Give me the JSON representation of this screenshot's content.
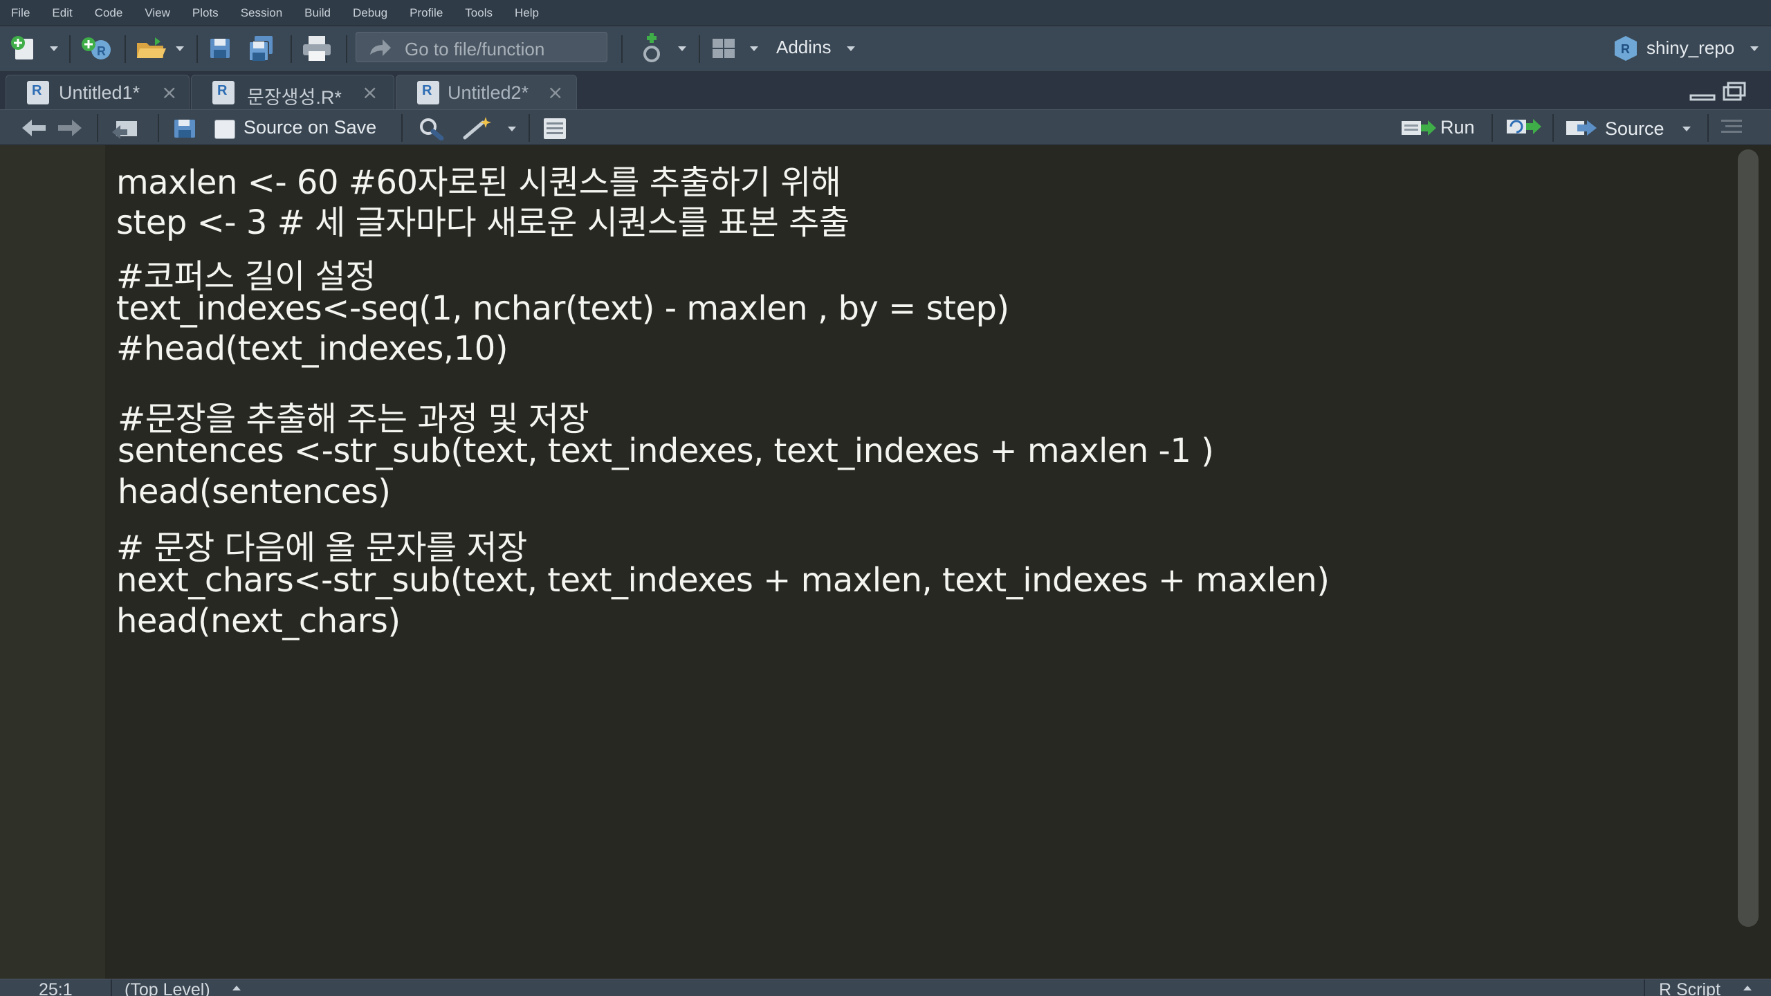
{
  "menu": [
    "File",
    "Edit",
    "Code",
    "View",
    "Plots",
    "Session",
    "Build",
    "Debug",
    "Profile",
    "Tools",
    "Help"
  ],
  "toolbar": {
    "goto_placeholder": "Go to file/function",
    "addins_label": "Addins",
    "project_label": "shiny_repo"
  },
  "tabs": [
    {
      "label": "Untitled1*",
      "active": false
    },
    {
      "label": "문장생성.R*",
      "active": false
    },
    {
      "label": "Untitled2*",
      "active": true
    }
  ],
  "editor_toolbar": {
    "source_on_save_label": "Source on Save",
    "source_on_save_checked": false,
    "run_label": "Run",
    "source_label": "Source"
  },
  "code_lines": [
    "maxlen <- 60 #60자로된 시퀀스를 추출하기 위해",
    "step <- 3 # 세 글자마다 새로운 시퀀스를 표본 추출",
    "#코퍼스 길이 설정",
    "text_indexes<-seq(1, nchar(text) - maxlen , by = step)",
    "#head(text_indexes,10)",
    "#문장을 추출해 주는 과정 및 저장",
    "sentences <-str_sub(text, text_indexes, text_indexes + maxlen -1 )",
    "head(sentences)",
    "# 문장 다음에 올 문자를 저장",
    "next_chars<-str_sub(text, text_indexes + maxlen, text_indexes + maxlen)",
    "head(next_chars)"
  ],
  "status": {
    "cursor_position": "25:1",
    "scope": "(Top Level)",
    "file_type": "R Script"
  },
  "colors": {
    "editor_bg": "#272822",
    "gutter_bg": "#2f3129",
    "toolbar_bg": "#3a4754",
    "code_text": "#f4f4f1"
  }
}
